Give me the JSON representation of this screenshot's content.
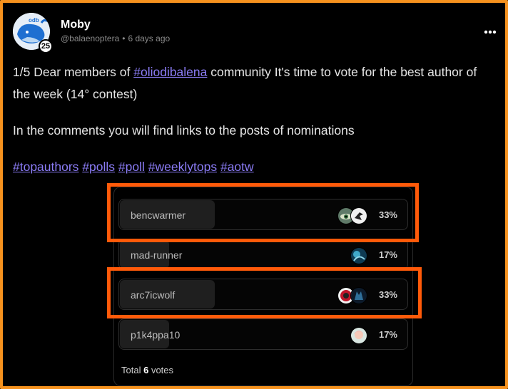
{
  "author": {
    "name": "Moby",
    "handle": "@balaenoptera",
    "time": "6 days ago",
    "badge": "25"
  },
  "post": {
    "line1_prefix": "1/5 Dear members of ",
    "line1_tag": "#oliodibalena",
    "line1_suffix": " community It's time to vote for the best author of the week (14° contest)",
    "line2": "In the comments you will find links to the posts of nominations",
    "tags": [
      "#topauthors",
      "#polls",
      "#poll",
      "#weeklytops",
      "#aotw"
    ]
  },
  "poll": {
    "options": [
      {
        "label": "bencwarmer",
        "percent": "33%",
        "fill_fraction": 0.33,
        "voters": [
          "eye-avatar",
          "bird-avatar"
        ],
        "highlighted": true
      },
      {
        "label": "mad-runner",
        "percent": "17%",
        "fill_fraction": 0.17,
        "voters": [
          "cosmic-avatar"
        ],
        "highlighted": false
      },
      {
        "label": "arc7icwolf",
        "percent": "33%",
        "fill_fraction": 0.33,
        "voters": [
          "red-avatar",
          "wolf-avatar"
        ],
        "highlighted": true
      },
      {
        "label": "p1k4ppa10",
        "percent": "17%",
        "fill_fraction": 0.17,
        "voters": [
          "girl-avatar"
        ],
        "highlighted": false
      }
    ],
    "total_prefix": "Total",
    "total_count": "6",
    "total_suffix": "votes"
  },
  "colors": {
    "highlight": "#ff5a09",
    "frame": "#f6921e",
    "link": "#8b7cf6"
  }
}
